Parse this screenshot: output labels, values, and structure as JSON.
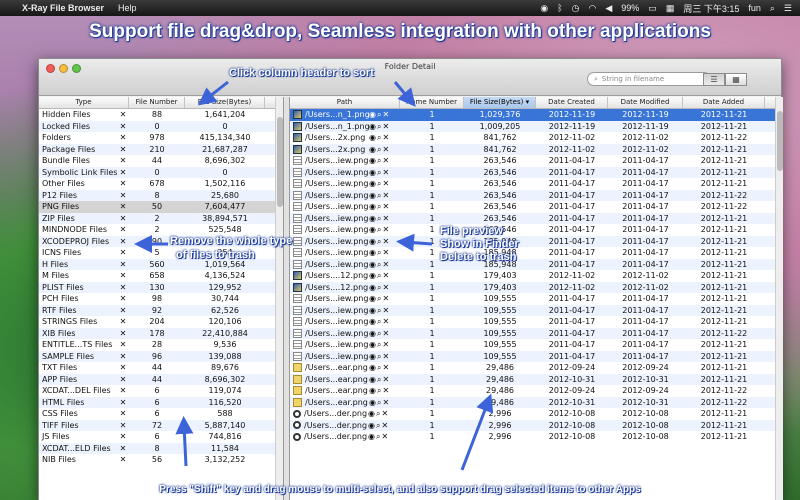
{
  "menubar": {
    "app_name": "X-Ray File Browser",
    "menu_help": "Help",
    "battery": "99%",
    "clock": "周三 下午3:15",
    "user": "fun"
  },
  "headline": "Support file drag&drop, Seamless integration with other applications",
  "window": {
    "title": "Folder Detail",
    "search_placeholder": "String in filename"
  },
  "left_table": {
    "headers": [
      "Type",
      "File Number",
      "File Size(Bytes)"
    ],
    "rows": [
      [
        "Hidden Files",
        "88",
        "1,641,204"
      ],
      [
        "Locked Files",
        "0",
        "0"
      ],
      [
        "Folders",
        "978",
        "415,134,340"
      ],
      [
        "Package Files",
        "210",
        "21,687,287"
      ],
      [
        "Bundle Files",
        "44",
        "8,696,302"
      ],
      [
        "Symbolic Link Files",
        "0",
        "0"
      ],
      [
        "Other Files",
        "678",
        "1,502,116"
      ],
      [
        "P12 Files",
        "8",
        "25,680"
      ],
      [
        "PNG Files",
        "50",
        "7,604,477"
      ],
      [
        "ZIP Files",
        "2",
        "38,894,571"
      ],
      [
        "MINDNODE Files",
        "2",
        "525,548"
      ],
      [
        "XCODEPROJ Files",
        "90",
        ""
      ],
      [
        "ICNS Files",
        "5",
        "254"
      ],
      [
        "H Files",
        "560",
        "1,019,564"
      ],
      [
        "M Files",
        "658",
        "4,136,524"
      ],
      [
        "PLIST Files",
        "130",
        "129,952"
      ],
      [
        "PCH Files",
        "98",
        "30,744"
      ],
      [
        "RTF Files",
        "92",
        "62,526"
      ],
      [
        "STRINGS Files",
        "204",
        "120,106"
      ],
      [
        "XIB Files",
        "178",
        "22,410,884"
      ],
      [
        "ENTITLE...TS Files",
        "28",
        "9,536"
      ],
      [
        "SAMPLE Files",
        "96",
        "139,088"
      ],
      [
        "TXT Files",
        "44",
        "89,676"
      ],
      [
        "APP Files",
        "44",
        "8,696,302"
      ],
      [
        "XCDAT...DEL Files",
        "6",
        "119,074"
      ],
      [
        "HTML Files",
        "6",
        "116,520"
      ],
      [
        "CSS Files",
        "6",
        "588"
      ],
      [
        "TIFF Files",
        "72",
        "5,887,140"
      ],
      [
        "JS Files",
        "6",
        "744,816"
      ],
      [
        "XCDAT...ELD Files",
        "8",
        "11,584"
      ],
      [
        "NIB Files",
        "56",
        "3,132,252"
      ]
    ]
  },
  "right_table": {
    "headers": [
      "Path",
      "Name Number",
      "File Size(Bytes)",
      "Date Created",
      "Date Modified",
      "Date Added"
    ],
    "rows": [
      {
        "icon": "image-icon",
        "path": "/Users...n_1.png",
        "num": "1",
        "size": "1,029,376",
        "created": "2012-11-19",
        "modified": "2012-11-19",
        "added": "2012-11-21"
      },
      {
        "icon": "image-icon",
        "path": "/Users...n_1.png",
        "num": "1",
        "size": "1,009,205",
        "created": "2012-11-19",
        "modified": "2012-11-19",
        "added": "2012-11-21"
      },
      {
        "icon": "image-icon",
        "path": "/Users...2x.png",
        "num": "1",
        "size": "841,762",
        "created": "2012-11-02",
        "modified": "2012-11-02",
        "added": "2012-11-22"
      },
      {
        "icon": "image-icon",
        "path": "/Users...2x.png",
        "num": "1",
        "size": "841,762",
        "created": "2012-11-02",
        "modified": "2012-11-02",
        "added": "2012-11-21"
      },
      {
        "icon": "document-icon",
        "path": "/Users...iew.png",
        "num": "1",
        "size": "263,546",
        "created": "2011-04-17",
        "modified": "2011-04-17",
        "added": "2012-11-21"
      },
      {
        "icon": "document-icon",
        "path": "/Users...iew.png",
        "num": "1",
        "size": "263,546",
        "created": "2011-04-17",
        "modified": "2011-04-17",
        "added": "2012-11-21"
      },
      {
        "icon": "document-icon",
        "path": "/Users...iew.png",
        "num": "1",
        "size": "263,546",
        "created": "2011-04-17",
        "modified": "2011-04-17",
        "added": "2012-11-21"
      },
      {
        "icon": "document-icon",
        "path": "/Users...iew.png",
        "num": "1",
        "size": "263,546",
        "created": "2011-04-17",
        "modified": "2011-04-17",
        "added": "2012-11-22"
      },
      {
        "icon": "document-icon",
        "path": "/Users...iew.png",
        "num": "1",
        "size": "263,546",
        "created": "2011-04-17",
        "modified": "2011-04-17",
        "added": "2012-11-22"
      },
      {
        "icon": "document-icon",
        "path": "/Users...iew.png",
        "num": "1",
        "size": "263,546",
        "created": "2011-04-17",
        "modified": "2011-04-17",
        "added": "2012-11-21"
      },
      {
        "icon": "document-icon",
        "path": "/Users...iew.png",
        "num": "1",
        "size": "263,546",
        "created": "2011-04-17",
        "modified": "2011-04-17",
        "added": "2012-11-21"
      },
      {
        "icon": "document-icon",
        "path": "/Users...iew.png",
        "num": "1",
        "size": "185,948",
        "created": "2011-04-17",
        "modified": "2011-04-17",
        "added": "2012-11-21"
      },
      {
        "icon": "document-icon",
        "path": "/Users...iew.png",
        "num": "1",
        "size": "185,948",
        "created": "2011-04-17",
        "modified": "2011-04-17",
        "added": "2012-11-21"
      },
      {
        "icon": "document-icon",
        "path": "/Users...iew.png",
        "num": "1",
        "size": "185,948",
        "created": "2011-04-17",
        "modified": "2011-04-17",
        "added": "2012-11-21"
      },
      {
        "icon": "image-icon",
        "path": "/Users....12.png",
        "num": "1",
        "size": "179,403",
        "created": "2012-11-02",
        "modified": "2012-11-02",
        "added": "2012-11-21"
      },
      {
        "icon": "image-icon",
        "path": "/Users....12.png",
        "num": "1",
        "size": "179,403",
        "created": "2012-11-02",
        "modified": "2012-11-02",
        "added": "2012-11-21"
      },
      {
        "icon": "document-icon",
        "path": "/Users...iew.png",
        "num": "1",
        "size": "109,555",
        "created": "2011-04-17",
        "modified": "2011-04-17",
        "added": "2012-11-21"
      },
      {
        "icon": "document-icon",
        "path": "/Users...iew.png",
        "num": "1",
        "size": "109,555",
        "created": "2011-04-17",
        "modified": "2011-04-17",
        "added": "2012-11-21"
      },
      {
        "icon": "document-icon",
        "path": "/Users...iew.png",
        "num": "1",
        "size": "109,555",
        "created": "2011-04-17",
        "modified": "2011-04-17",
        "added": "2012-11-21"
      },
      {
        "icon": "document-icon",
        "path": "/Users...iew.png",
        "num": "1",
        "size": "109,555",
        "created": "2011-04-17",
        "modified": "2011-04-17",
        "added": "2012-11-22"
      },
      {
        "icon": "document-icon",
        "path": "/Users...iew.png",
        "num": "1",
        "size": "109,555",
        "created": "2011-04-17",
        "modified": "2011-04-17",
        "added": "2012-11-21"
      },
      {
        "icon": "document-icon",
        "path": "/Users...iew.png",
        "num": "1",
        "size": "109,555",
        "created": "2011-04-17",
        "modified": "2011-04-17",
        "added": "2012-11-21"
      },
      {
        "icon": "pen-icon",
        "path": "/Users...ear.png",
        "num": "1",
        "size": "29,486",
        "created": "2012-09-24",
        "modified": "2012-09-24",
        "added": "2012-11-21"
      },
      {
        "icon": "pen-icon",
        "path": "/Users...ear.png",
        "num": "1",
        "size": "29,486",
        "created": "2012-10-31",
        "modified": "2012-10-31",
        "added": "2012-11-21"
      },
      {
        "icon": "pen-icon",
        "path": "/Users...ear.png",
        "num": "1",
        "size": "29,486",
        "created": "2012-09-24",
        "modified": "2012-09-24",
        "added": "2012-11-22"
      },
      {
        "icon": "pen-icon",
        "path": "/Users...ear.png",
        "num": "1",
        "size": "29,486",
        "created": "2012-10-31",
        "modified": "2012-10-31",
        "added": "2012-11-22"
      },
      {
        "icon": "magnifier-icon",
        "path": "/Users...der.png",
        "num": "1",
        "size": "2,996",
        "created": "2012-10-08",
        "modified": "2012-10-08",
        "added": "2012-11-21"
      },
      {
        "icon": "magnifier-icon",
        "path": "/Users...der.png",
        "num": "1",
        "size": "2,996",
        "created": "2012-10-08",
        "modified": "2012-10-08",
        "added": "2012-11-21"
      },
      {
        "icon": "magnifier-icon",
        "path": "/Users...der.png",
        "num": "1",
        "size": "2,996",
        "created": "2012-10-08",
        "modified": "2012-10-08",
        "added": "2012-11-21"
      }
    ]
  },
  "annotations": {
    "sort_hint": "Click column header to sort",
    "remove_hint_1": "Remove the whole type",
    "remove_hint_2": "of files to trash",
    "preview": "File preview",
    "finder": "Show in Finder",
    "delete": "Delete to trash"
  },
  "footer": "Press \"Shift\" key and drag mouse to multi-select, and also support drag selected items to other Apps",
  "colors": {
    "selection": "#3875d7",
    "sorted_header": "#a9c7ee",
    "callout_text": "#ffffff",
    "callout_outline": "#1a3a9a"
  }
}
